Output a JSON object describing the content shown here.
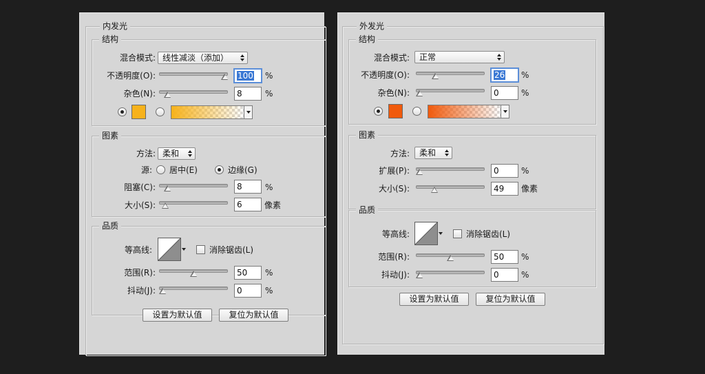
{
  "inner": {
    "title": "内发光",
    "structure": {
      "title": "结构",
      "blend_mode_label": "混合模式:",
      "blend_mode_value": "线性减淡（添加）",
      "opacity_label": "不透明度(O):",
      "opacity_value": "100",
      "opacity_unit": "%",
      "opacity_level": 100,
      "noise_label": "杂色(N):",
      "noise_value": "8",
      "noise_unit": "%",
      "noise_level": 8
    },
    "elements": {
      "title": "图素",
      "method_label": "方法:",
      "method_value": "柔和",
      "source_label": "源:",
      "source_center_label": "居中(E)",
      "source_edge_label": "边缘(G)",
      "choke_label": "阻塞(C):",
      "choke_value": "8",
      "choke_unit": "%",
      "choke_level": 8,
      "size_label": "大小(S):",
      "size_value": "6",
      "size_unit": "像素",
      "size_level": 4
    },
    "quality": {
      "title": "品质",
      "contour_label": "等高线:",
      "anti_alias_label": "消除锯齿(L)",
      "range_label": "范围(R):",
      "range_value": "50",
      "range_unit": "%",
      "range_level": 50,
      "jitter_label": "抖动(J):",
      "jitter_value": "0",
      "jitter_unit": "%",
      "jitter_level": 0
    },
    "set_default_label": "设置为默认值",
    "reset_default_label": "复位为默认值"
  },
  "outer": {
    "title": "外发光",
    "structure": {
      "title": "结构",
      "blend_mode_label": "混合模式:",
      "blend_mode_value": "正常",
      "opacity_label": "不透明度(O):",
      "opacity_value": "26",
      "opacity_unit": "%",
      "opacity_level": 26,
      "noise_label": "杂色(N):",
      "noise_value": "0",
      "noise_unit": "%",
      "noise_level": 0
    },
    "elements": {
      "title": "图素",
      "method_label": "方法:",
      "method_value": "柔和",
      "spread_label": "扩展(P):",
      "spread_value": "0",
      "spread_unit": "%",
      "spread_level": 0,
      "size_label": "大小(S):",
      "size_value": "49",
      "size_unit": "像素",
      "size_level": 24
    },
    "quality": {
      "title": "品质",
      "contour_label": "等高线:",
      "anti_alias_label": "消除锯齿(L)",
      "range_label": "范围(R):",
      "range_value": "50",
      "range_unit": "%",
      "range_level": 50,
      "jitter_label": "抖动(J):",
      "jitter_value": "0",
      "jitter_unit": "%",
      "jitter_level": 0
    },
    "set_default_label": "设置为默认值",
    "reset_default_label": "复位为默认值"
  },
  "colors": {
    "background": "#1e1e1e",
    "panel": "#d6d6d6",
    "inner_glow_color": "#f7b21b",
    "outer_glow_color": "#f05a0c"
  }
}
